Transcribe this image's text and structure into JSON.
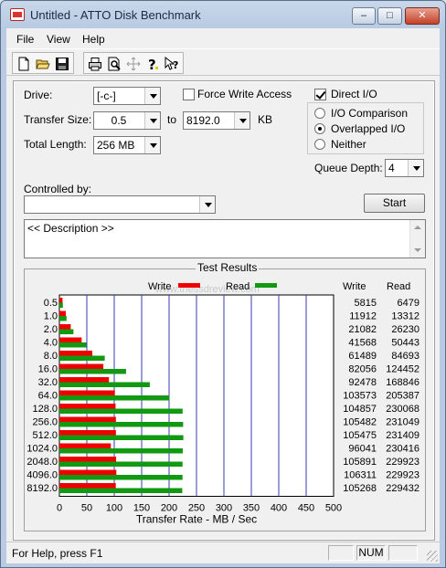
{
  "window": {
    "title": "Untitled - ATTO Disk Benchmark",
    "minimize": "–",
    "maximize": "□",
    "close": "✕"
  },
  "menu": {
    "items": [
      "File",
      "View",
      "Help"
    ]
  },
  "toolbar": {
    "icons": [
      "new-icon",
      "open-icon",
      "save-icon",
      "print-icon",
      "print-preview-icon",
      "move-icon",
      "help-icon",
      "context-help-icon"
    ]
  },
  "settings": {
    "drive_label": "Drive:",
    "drive_value": "[-c-]",
    "force_write_label": "Force Write Access",
    "force_write_checked": false,
    "direct_io_label": "Direct I/O",
    "direct_io_checked": true,
    "transfer_size_label": "Transfer Size:",
    "transfer_from": "0.5",
    "to_label": "to",
    "transfer_to": "8192.0",
    "kb_label": "KB",
    "total_length_label": "Total Length:",
    "total_length_value": "256 MB",
    "io_options": [
      "I/O Comparison",
      "Overlapped I/O",
      "Neither"
    ],
    "io_selected": 1,
    "queue_depth_label": "Queue Depth:",
    "queue_depth_value": "4",
    "controlled_by_label": "Controlled by:",
    "controlled_by_value": "",
    "start_label": "Start",
    "description": "<< Description >>"
  },
  "results": {
    "title": "Test Results",
    "write_legend": "Write",
    "read_legend": "Read",
    "write_col": "Write",
    "read_col": "Read",
    "xlabel": "Transfer Rate - MB / Sec",
    "watermark": "www.thessdreview.com"
  },
  "chart_data": {
    "type": "bar",
    "orientation": "horizontal",
    "title": "Test Results",
    "xlabel": "Transfer Rate - MB / Sec",
    "xlim": [
      0,
      500
    ],
    "xticks": [
      0,
      50,
      100,
      150,
      200,
      250,
      300,
      350,
      400,
      450,
      500
    ],
    "grid": true,
    "legend": "top",
    "colors": {
      "write": "#ee0000",
      "read": "#119911"
    },
    "categories": [
      "0.5",
      "1.0",
      "2.0",
      "4.0",
      "8.0",
      "16.0",
      "32.0",
      "64.0",
      "128.0",
      "256.0",
      "512.0",
      "1024.0",
      "2048.0",
      "4096.0",
      "8192.0"
    ],
    "series": [
      {
        "name": "Write",
        "values": [
          5815,
          11912,
          21082,
          41568,
          61489,
          82056,
          92478,
          103573,
          104857,
          105482,
          105475,
          96041,
          105891,
          106311,
          105268
        ]
      },
      {
        "name": "Read",
        "values": [
          6479,
          13312,
          26230,
          50443,
          84693,
          124452,
          168846,
          205387,
          230068,
          231049,
          231409,
          230416,
          229923,
          229923,
          229432
        ]
      }
    ]
  },
  "status": {
    "help_text": "For Help, press F1",
    "pane1": "",
    "num": "NUM",
    "pane3": ""
  }
}
